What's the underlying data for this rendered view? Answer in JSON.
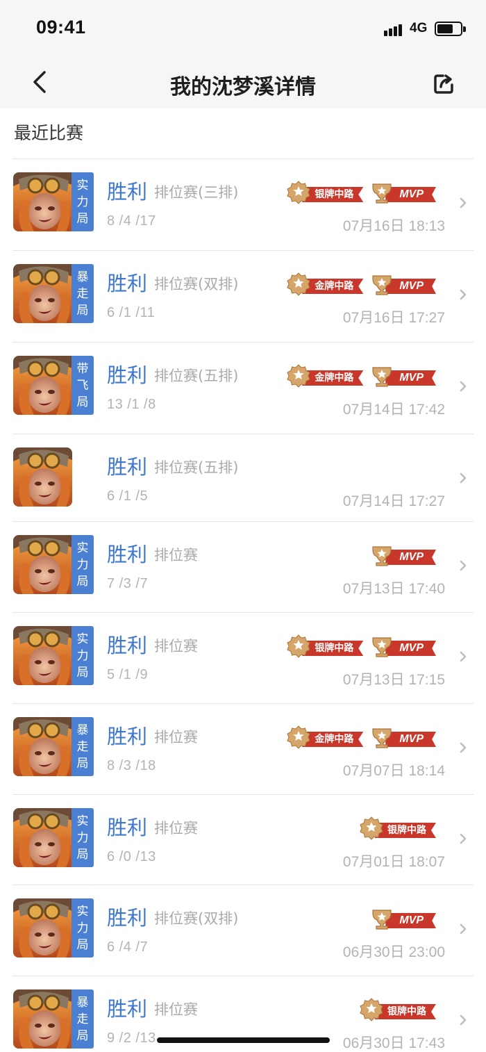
{
  "status_bar": {
    "time": "09:41",
    "network": "4G"
  },
  "nav": {
    "title": "我的沈梦溪详情"
  },
  "section": {
    "title": "最近比赛"
  },
  "colors": {
    "accent": "#3e77cf",
    "tag": "#4a7fd1",
    "ribbon": "#c9362a",
    "medal": "#d6a56a"
  },
  "matches": [
    {
      "tag": "实力局",
      "result": "胜利",
      "mode": "排位赛(三排)",
      "kda": "8 /4 /17",
      "time": "07月16日 18:13",
      "badges": [
        "银牌中路",
        "MVP"
      ]
    },
    {
      "tag": "暴走局",
      "result": "胜利",
      "mode": "排位赛(双排)",
      "kda": "6 /1 /11",
      "time": "07月16日 17:27",
      "badges": [
        "金牌中路",
        "MVP"
      ]
    },
    {
      "tag": "带飞局",
      "result": "胜利",
      "mode": "排位赛(五排)",
      "kda": "13 /1 /8",
      "time": "07月14日 17:42",
      "badges": [
        "金牌中路",
        "MVP"
      ]
    },
    {
      "tag": "",
      "result": "胜利",
      "mode": "排位赛(五排)",
      "kda": "6 /1 /5",
      "time": "07月14日 17:27",
      "badges": []
    },
    {
      "tag": "实力局",
      "result": "胜利",
      "mode": "排位赛",
      "kda": "7 /3 /7",
      "time": "07月13日 17:40",
      "badges": [
        "MVP"
      ]
    },
    {
      "tag": "实力局",
      "result": "胜利",
      "mode": "排位赛",
      "kda": "5 /1 /9",
      "time": "07月13日 17:15",
      "badges": [
        "银牌中路",
        "MVP"
      ]
    },
    {
      "tag": "暴走局",
      "result": "胜利",
      "mode": "排位赛",
      "kda": "8 /3 /18",
      "time": "07月07日 18:14",
      "badges": [
        "金牌中路",
        "MVP"
      ]
    },
    {
      "tag": "实力局",
      "result": "胜利",
      "mode": "排位赛",
      "kda": "6 /0 /13",
      "time": "07月01日 18:07",
      "badges": [
        "银牌中路"
      ]
    },
    {
      "tag": "实力局",
      "result": "胜利",
      "mode": "排位赛(双排)",
      "kda": "6 /4 /7",
      "time": "06月30日 23:00",
      "badges": [
        "MVP"
      ]
    },
    {
      "tag": "暴走局",
      "result": "胜利",
      "mode": "排位赛",
      "kda": "9 /2 /13",
      "time": "06月30日 17:43",
      "badges": [
        "银牌中路"
      ]
    }
  ]
}
